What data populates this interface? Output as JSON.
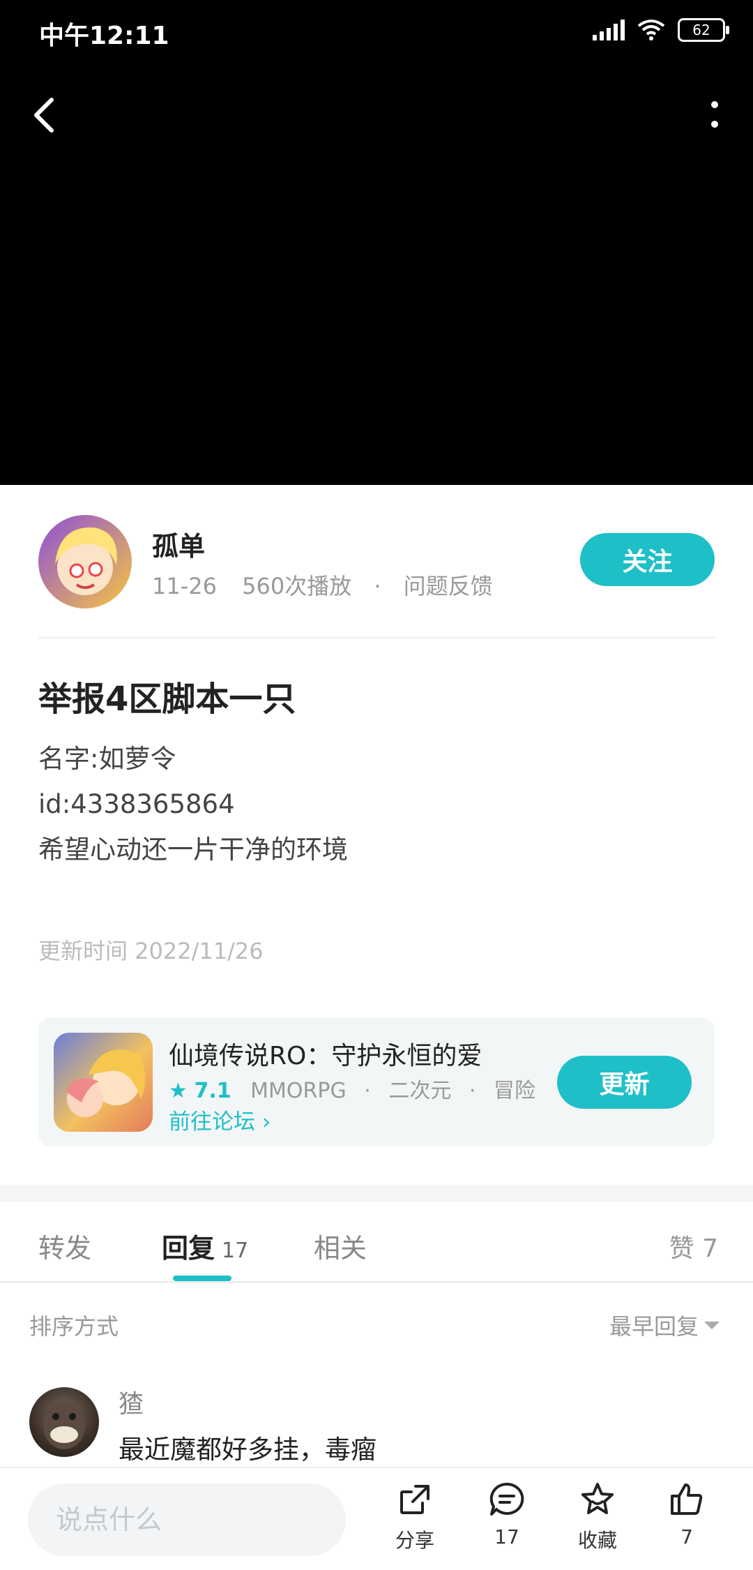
{
  "status_bar": {
    "time": "中午12:11",
    "battery": "62"
  },
  "author": {
    "name": "孤单",
    "date": "11-26",
    "plays": "560次播放",
    "separator": "·",
    "category": "问题反馈",
    "follow_label": "关注"
  },
  "post": {
    "title": "举报4区脚本一只",
    "lines": [
      "名字:如萝令",
      "id:4338365864",
      "希望心动还一片干净的环境"
    ],
    "update_time": "更新时间 2022/11/26"
  },
  "game": {
    "name": "仙境传说RO：守护永恒的爱",
    "rating": "7.1",
    "tags": [
      "MMORPG",
      "二次元",
      "冒险"
    ],
    "tag_separator": "·",
    "forum_link": "前往论坛",
    "update_label": "更新"
  },
  "tabs": {
    "forward": "转发",
    "reply": "回复",
    "reply_count": "17",
    "related": "相关",
    "likes": "赞 7"
  },
  "sort": {
    "label": "排序方式",
    "value": "最早回复"
  },
  "comment": {
    "user": "猹",
    "text": "最近魔都好多挂，毒瘤"
  },
  "bottom_bar": {
    "input_placeholder": "说点什么",
    "share_label": "分享",
    "comment_count": "17",
    "favorite_label": "收藏",
    "like_count": "7"
  },
  "colors": {
    "accent": "#1fbfc7",
    "video_bg": "#000000"
  }
}
